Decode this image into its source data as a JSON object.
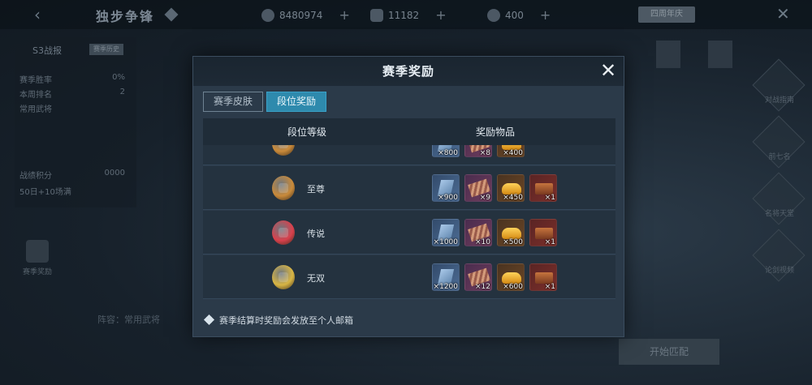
{
  "background": {
    "back_glyph": "‹",
    "title": "独步争锋",
    "resources": [
      {
        "icon": "coin-icon",
        "value": "8480974"
      },
      {
        "icon": "gold-ingot-icon",
        "value": "11182"
      },
      {
        "icon": "crystal-icon",
        "value": "400"
      }
    ],
    "top_button": "四周年庆",
    "close_glyph": "✕",
    "season_panel": {
      "title": "S3战报",
      "badge": "赛季历史",
      "rows": [
        {
          "label": "赛季胜率",
          "value": "0%"
        },
        {
          "label": "本周排名",
          "value": "2"
        },
        {
          "label": "常用武将",
          "value": ""
        }
      ],
      "points_label": "战绩积分",
      "points_value": "0000",
      "rank_note": "50日+10场满"
    },
    "trophy_label": "赛季奖励",
    "bottom_label": "阵容：常用武将",
    "match_button": "开始匹配",
    "right_menu": [
      "对战指南",
      "前七名",
      "名将天堂",
      "论剑视频"
    ]
  },
  "modal": {
    "title": "赛季奖励",
    "close_glyph": "✕",
    "tabs": [
      {
        "label": "赛季皮肤",
        "active": false
      },
      {
        "label": "段位奖励",
        "active": true
      }
    ],
    "columns": {
      "rank": "段位等级",
      "rewards": "奖励物品"
    },
    "rows": [
      {
        "rank": "",
        "icon_color": "#c98a3a",
        "items": [
          {
            "type": "blue",
            "qty": "×800"
          },
          {
            "type": "purple",
            "qty": "×8"
          },
          {
            "type": "gold",
            "qty": "×400"
          }
        ]
      },
      {
        "rank": "至尊",
        "icon_color": "#c98a3a",
        "items": [
          {
            "type": "blue",
            "qty": "×900"
          },
          {
            "type": "purple",
            "qty": "×9"
          },
          {
            "type": "gold",
            "qty": "×450"
          },
          {
            "type": "red",
            "qty": "×1"
          }
        ]
      },
      {
        "rank": "传说",
        "icon_color": "#d8414d",
        "items": [
          {
            "type": "blue",
            "qty": "×1000"
          },
          {
            "type": "purple",
            "qty": "×10"
          },
          {
            "type": "gold",
            "qty": "×500"
          },
          {
            "type": "red",
            "qty": "×1"
          }
        ]
      },
      {
        "rank": "无双",
        "icon_color": "#d8b544",
        "items": [
          {
            "type": "blue",
            "qty": "×1200"
          },
          {
            "type": "purple",
            "qty": "×12"
          },
          {
            "type": "gold",
            "qty": "×600"
          },
          {
            "type": "red",
            "qty": "×1"
          }
        ]
      }
    ],
    "footer_note": "赛季结算时奖励会发放至个人邮箱"
  }
}
